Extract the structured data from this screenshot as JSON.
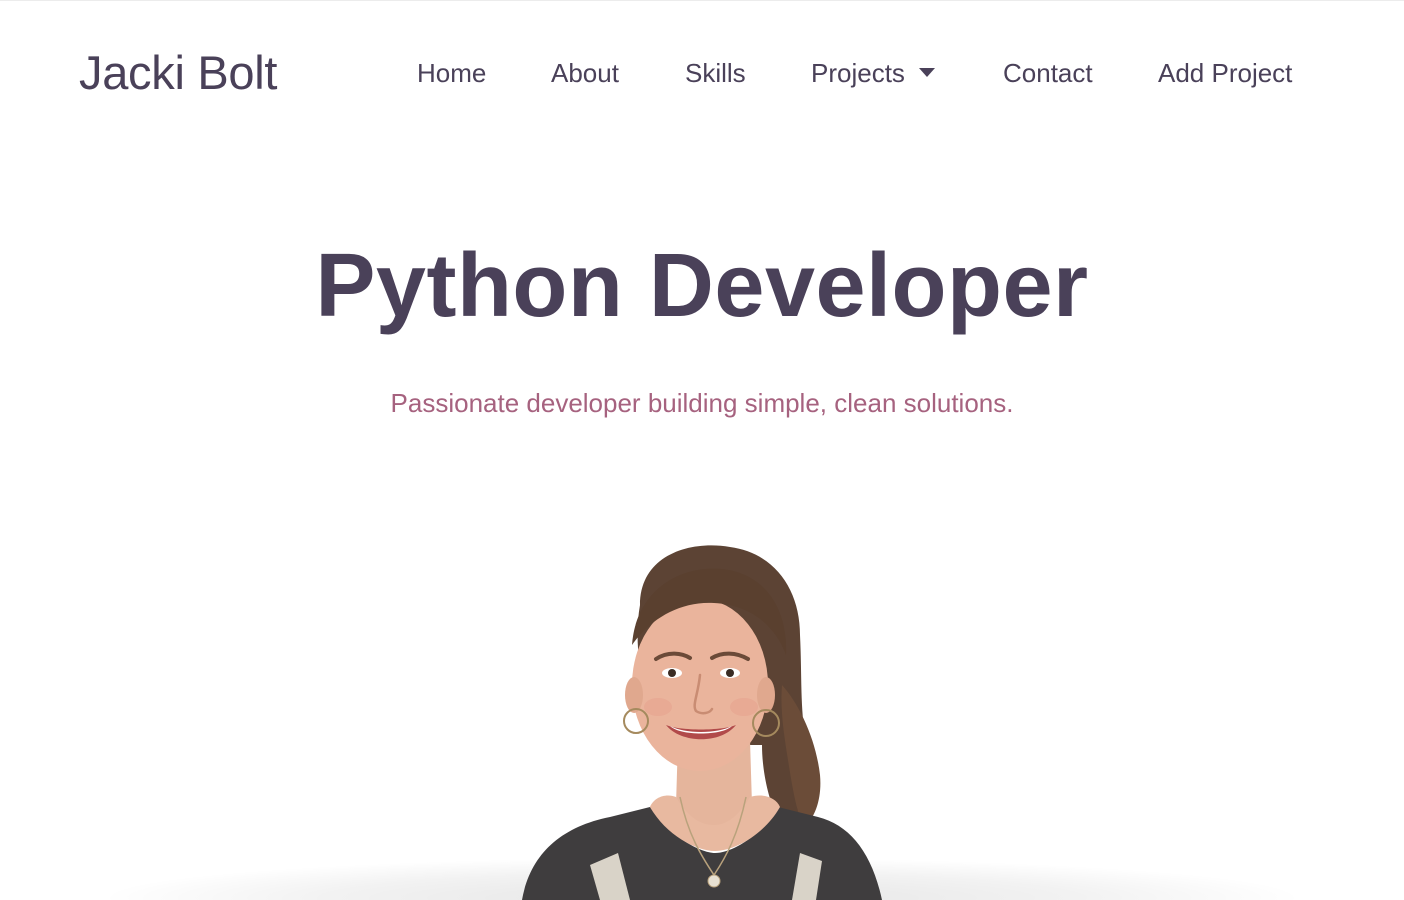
{
  "brand": {
    "name": "Jacki Bolt"
  },
  "nav": {
    "items": [
      {
        "label": "Home"
      },
      {
        "label": "About"
      },
      {
        "label": "Skills"
      },
      {
        "label": "Projects",
        "has_dropdown": true,
        "icon": "caret-down-icon"
      },
      {
        "label": "Contact"
      },
      {
        "label": "Add Project"
      }
    ]
  },
  "hero": {
    "title": "Python Developer",
    "subtitle": "Passionate developer building simple, clean solutions."
  },
  "colors": {
    "primary": "#4a4159",
    "accent": "#a6627f",
    "background": "#ffffff"
  }
}
